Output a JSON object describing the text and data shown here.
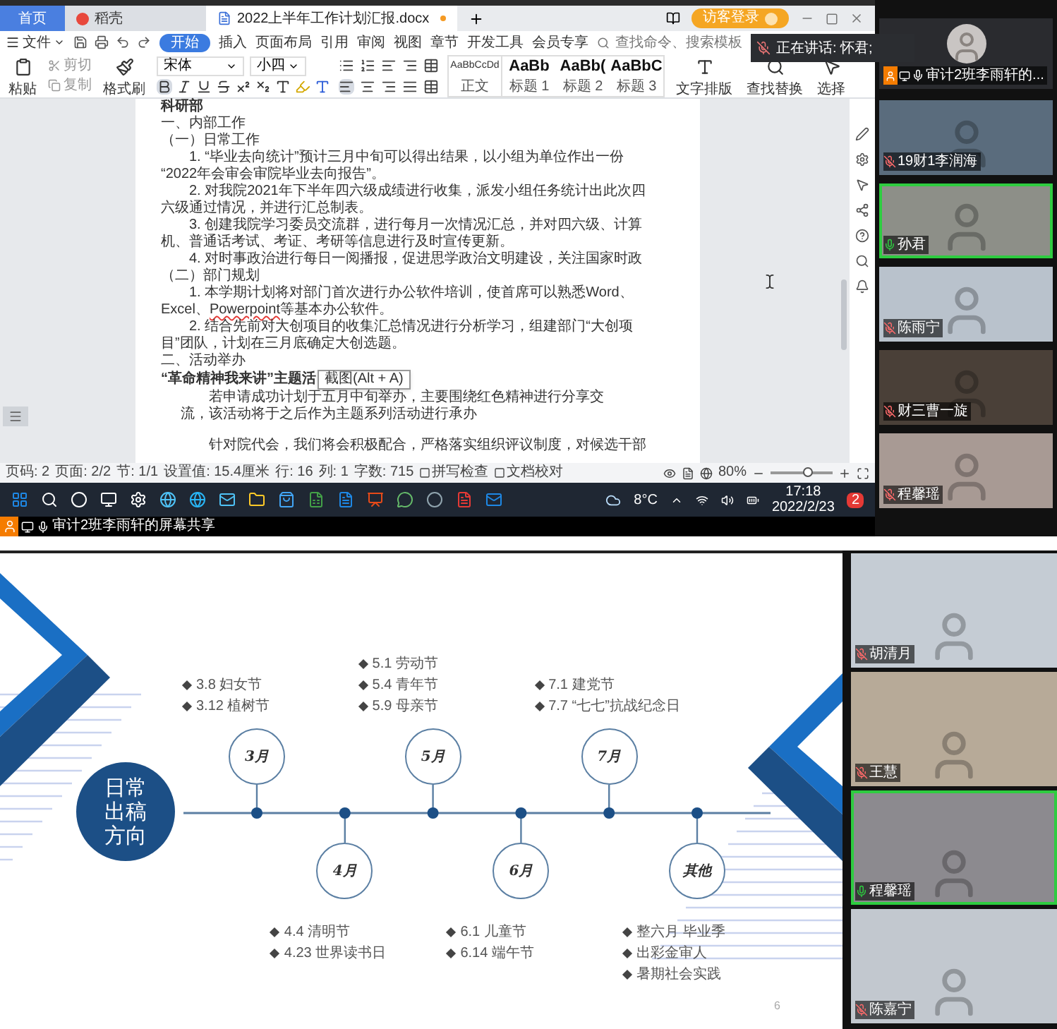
{
  "share_window": {
    "tabs": [
      {
        "label": "首页",
        "kind": "home",
        "selected": false
      },
      {
        "label": "稻壳",
        "kind": "app",
        "selected": false
      },
      {
        "label": "2022上半年工作计划汇报.docx",
        "kind": "doc",
        "selected": true
      }
    ],
    "guest_login": "访客登录",
    "menu": {
      "file": "文件",
      "items": [
        {
          "label": "开始",
          "selected": true
        },
        {
          "label": "插入",
          "selected": false
        },
        {
          "label": "页面布局",
          "selected": false
        },
        {
          "label": "引用",
          "selected": false
        },
        {
          "label": "审阅",
          "selected": false
        },
        {
          "label": "视图",
          "selected": false
        },
        {
          "label": "章节",
          "selected": false
        },
        {
          "label": "开发工具",
          "selected": false
        },
        {
          "label": "会员专享",
          "selected": false
        }
      ],
      "search_placeholder": "查找命令、搜索模板"
    },
    "speaker_notice": "正在讲话: 怀君;",
    "ribbon": {
      "paste": "粘贴",
      "cut": "剪切",
      "copy": "复制",
      "format_painter": "格式刷",
      "font": "宋体",
      "font_size": "小四",
      "styles": [
        {
          "sample": "AaBbCcDd",
          "label": "正文"
        },
        {
          "sample": "AaBb",
          "label": "标题 1"
        },
        {
          "sample": "AaBb(",
          "label": "标题 2"
        },
        {
          "sample": "AaBbC",
          "label": "标题 3"
        }
      ],
      "tools": [
        "文字排版",
        "查找替换",
        "选择"
      ]
    },
    "document": [
      {
        "kind": "bold",
        "text": "科研部"
      },
      {
        "kind": "plain",
        "text": "一、内部工作"
      },
      {
        "kind": "plain",
        "text": "（一）日常工作"
      },
      {
        "kind": "indent",
        "text": "1. “毕业去向统计”预计三月中旬可以得出结果，以小组为单位作出一份"
      },
      {
        "kind": "plain",
        "text": "“2022年会审会审院毕业去向报告”。"
      },
      {
        "kind": "indent",
        "text": "2. 对我院2021年下半年四六级成绩进行收集，派发小组任务统计出此次四"
      },
      {
        "kind": "plain",
        "text": "六级通过情况，并进行汇总制表。"
      },
      {
        "kind": "indent",
        "text": "3. 创建我院学习委员交流群，进行每月一次情况汇总，并对四六级、计算"
      },
      {
        "kind": "plain",
        "text": "机、普通话考试、考证、考研等信息进行及时宣传更新。"
      },
      {
        "kind": "indent",
        "text": "4. 对时事政治进行每日一阅播报，促进思学政治文明建设，关注国家时政"
      },
      {
        "kind": "plain",
        "text": "（二）部门规划"
      },
      {
        "kind": "indent",
        "text": "1. 本学期计划将对部门首次进行办公软件培训，使首席可以熟悉Word、"
      },
      {
        "kind": "plain",
        "parts": [
          {
            "text": "Excel、",
            "misspelled": false
          },
          {
            "text": "Powerpoint",
            "misspelled": true
          },
          {
            "text": "等基本办公软件。",
            "misspelled": false
          }
        ]
      },
      {
        "kind": "indent",
        "text": "2. 结合先前对大创项目的收集汇总情况进行分析学习，组建部门“大创项"
      },
      {
        "kind": "plain",
        "text": "目”团队，计划在三月底确定大创选题。"
      },
      {
        "kind": "plain",
        "text": "二、活动举办"
      },
      {
        "kind": "bold",
        "text": "“革命精神我来讲”主题活",
        "tooltip": "截图(Alt + A)"
      },
      {
        "kind": "deep",
        "text": "若申请成功计划于五月中旬举办，主要围绕红色精神进行分享交"
      },
      {
        "kind": "half",
        "text": "流，该活动将于之后作为主题系列活动进行承办"
      },
      {
        "kind": "gap"
      },
      {
        "kind": "deep",
        "text": "针对院代会，我们将会积极配合，严格落实组织评议制度，对候选干部"
      }
    ],
    "status_bar": {
      "items": [
        "页码: 2",
        "页面: 2/2",
        "节: 1/1",
        "设置值: 15.4厘米",
        "行: 16",
        "列: 1",
        "字数: 715"
      ],
      "spell_check": "拼写检查",
      "proofread": "文档校对",
      "zoom": "80%",
      "zoom_slider": {
        "level": 0.6
      }
    },
    "taskbar": {
      "weather": "8°C",
      "time": "17:18",
      "date": "2022/2/23",
      "notifications": "2"
    },
    "share_banner": "审计2班李雨轩的屏幕共享"
  },
  "participants_top": [
    {
      "kind": "avatar",
      "name": "审计2班李雨轩的...",
      "muted": false,
      "speaking": false,
      "presenter": true
    },
    {
      "kind": "video",
      "name": "19财1李润海",
      "muted": true,
      "speaking": false,
      "presenter": false
    },
    {
      "kind": "video",
      "name": "孙君",
      "muted": false,
      "speaking": true,
      "presenter": false
    },
    {
      "kind": "video",
      "name": "陈雨宁",
      "muted": true,
      "speaking": false,
      "presenter": false
    },
    {
      "kind": "video",
      "name": "财三曹一旋",
      "muted": true,
      "speaking": false,
      "presenter": false
    },
    {
      "kind": "video",
      "name": "程馨瑶",
      "muted": true,
      "speaking": false,
      "presenter": false
    }
  ],
  "slide": {
    "title": "日常出稿方向",
    "page": "6",
    "timeline": [
      {
        "month": "3月",
        "kind": "above",
        "notes": [
          "3.8 妇女节",
          "3.12 植树节"
        ]
      },
      {
        "month": "4月",
        "kind": "below",
        "notes": [
          "4.4 清明节",
          "4.23 世界读书日"
        ]
      },
      {
        "month": "5月",
        "kind": "above",
        "notes": [
          "5.1 劳动节",
          "5.4 青年节",
          "5.9 母亲节"
        ]
      },
      {
        "month": "6月",
        "kind": "below",
        "notes": [
          "6.1 儿童节",
          "6.14 端午节"
        ]
      },
      {
        "month": "7月",
        "kind": "above",
        "notes": [
          "7.1 建党节",
          "7.7 “七七”抗战纪念日"
        ]
      },
      {
        "month": "其他",
        "kind": "below",
        "notes": [
          "整六月 毕业季",
          "出彩金审人",
          "暑期社会实践"
        ]
      }
    ]
  },
  "participants_bottom": [
    {
      "name": "胡清月",
      "muted": true,
      "speaking": false
    },
    {
      "name": "王慧",
      "muted": true,
      "speaking": false
    },
    {
      "name": "程馨瑶",
      "muted": false,
      "speaking": true
    },
    {
      "name": "陈嘉宁",
      "muted": true,
      "speaking": false
    }
  ]
}
